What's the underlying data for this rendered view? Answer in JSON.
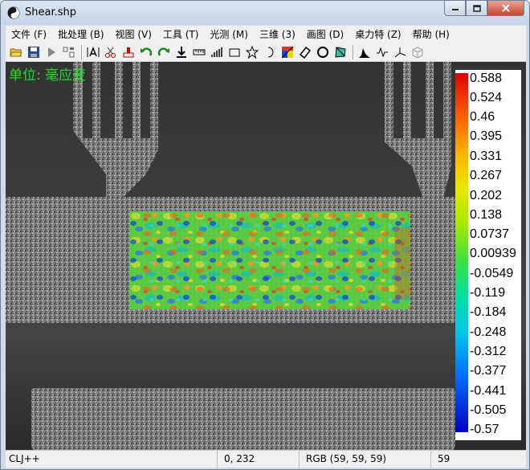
{
  "window": {
    "title": "Shear.shp"
  },
  "menu": [
    "文件 (F)",
    "批处理 (B)",
    "视图 (V)",
    "工具 (T)",
    "光测 (M)",
    "三维 (3)",
    "画图 (D)",
    "桌力特 (Z)",
    "帮助 (H)"
  ],
  "toolbar_icons": [
    "open-folder-icon",
    "save-icon",
    "play-icon",
    "layout-icon",
    "text-icon",
    "scissors-icon",
    "stamp-icon",
    "undo-icon",
    "redo-icon",
    "download-icon",
    "ruler-icon",
    "bar-graph-icon",
    "rectangle-icon",
    "star-icon",
    "moon-icon",
    "colormap-icon",
    "eraser-icon",
    "circle-icon",
    "polygon-icon",
    "peak-icon",
    "wave-icon",
    "axis-icon",
    "cube-icon"
  ],
  "canvas": {
    "unit_label": "单位: 毫应变"
  },
  "colorbar": {
    "labels": [
      "0.588",
      "0.524",
      "0.46",
      "0.395",
      "0.331",
      "0.267",
      "0.202",
      "0.138",
      "0.0737",
      "0.00939",
      "-0.0549",
      "-0.119",
      "-0.184",
      "-0.248",
      "-0.312",
      "-0.377",
      "-0.441",
      "-0.505",
      "-0.57"
    ],
    "colors": {
      "max": "#e00000",
      "mid": "#40e040",
      "min": "#0000c8"
    }
  },
  "statusbar": {
    "app": "CLJ++",
    "coords": "0, 232",
    "rgb": "RGB (59, 59, 59)",
    "value": "59"
  }
}
